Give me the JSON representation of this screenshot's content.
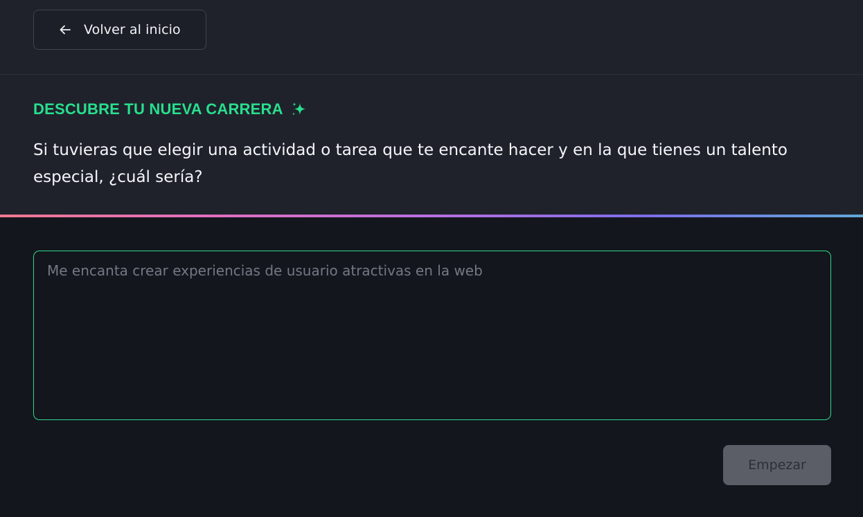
{
  "nav": {
    "back_label": "Volver al inicio",
    "back_icon": "arrow-left-icon"
  },
  "question": {
    "eyebrow": "DESCUBRE TU NUEVA CARRERA",
    "eyebrow_icon": "sparkles-icon",
    "text": "Si tuvieras que elegir una actividad o tarea que te encante hacer y en la que tienes un talento especial, ¿cuál sería?"
  },
  "answer": {
    "value": "",
    "placeholder": "Me encanta crear experiencias de usuario atractivas en la web"
  },
  "actions": {
    "start_label": "Empezar"
  },
  "colors": {
    "accent": "#28df8e",
    "background": "#13161d",
    "panel": "#1f222b",
    "button_disabled": "#5b5e66"
  }
}
